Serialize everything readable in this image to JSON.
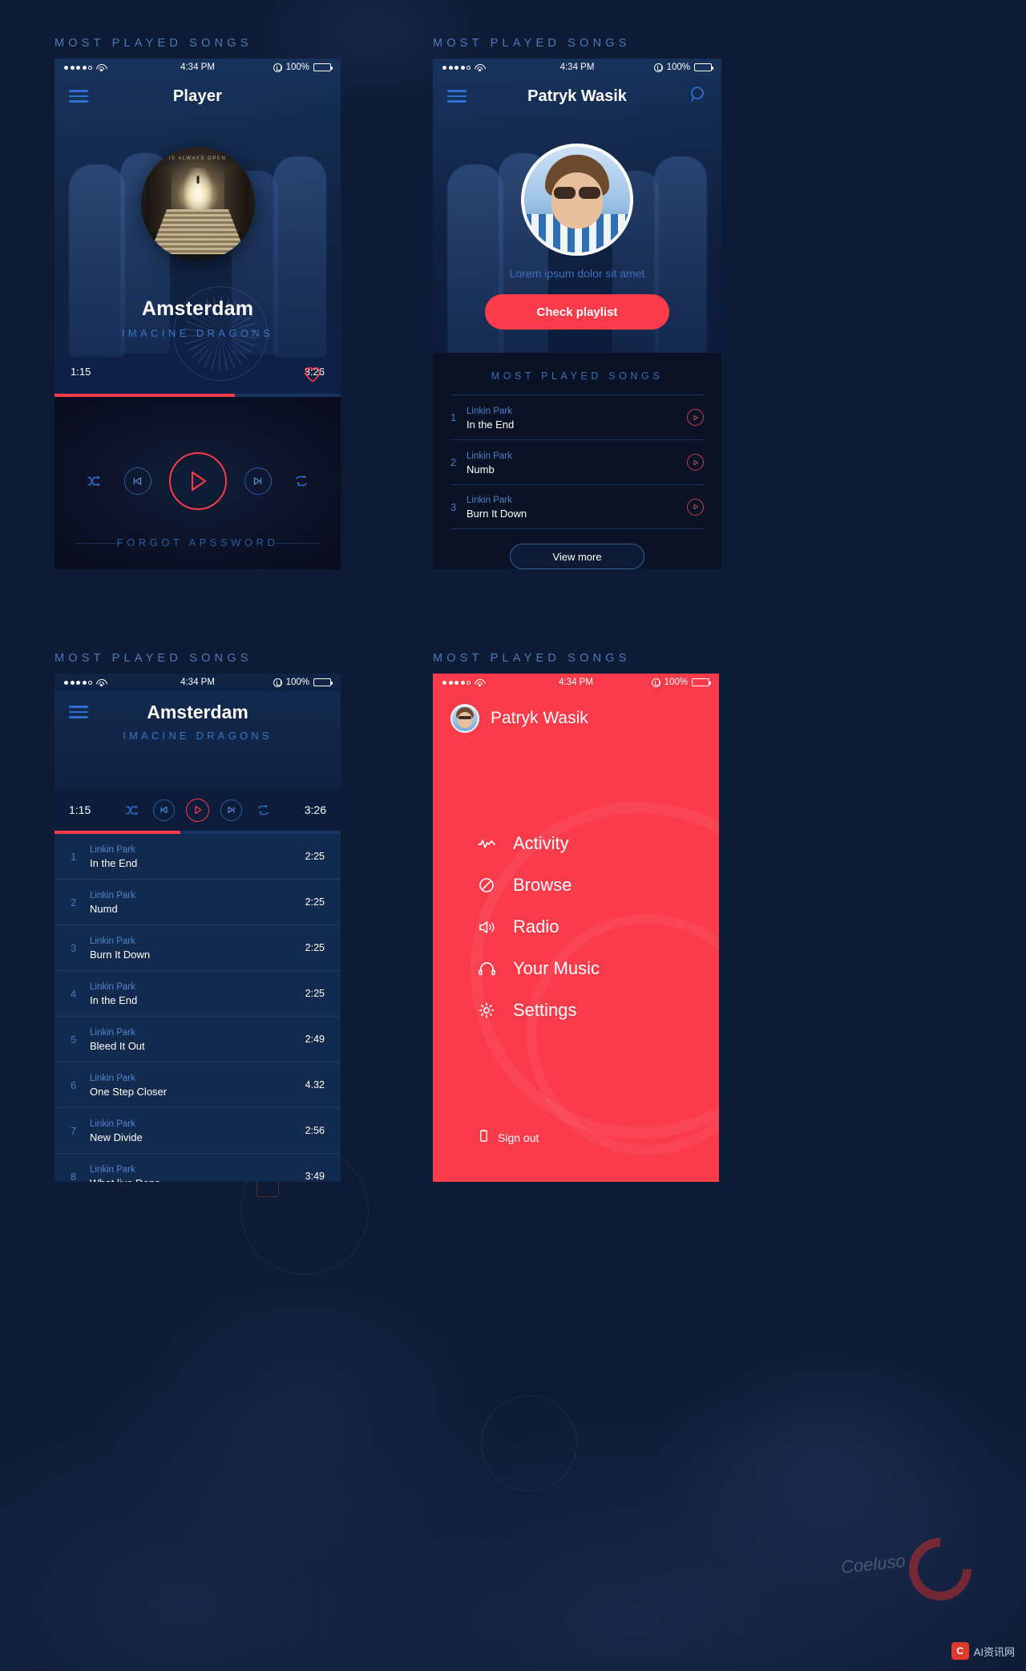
{
  "theme": {
    "accent_red": "#fa3b4a",
    "blue_text": "#3f74c4",
    "bg_dark_navy": "#0d1b35",
    "panel_navy": "#132a4f"
  },
  "section_labels": {
    "phone1": "MOST PLAYED SONGS",
    "phone2": "MOST PLAYED SONGS",
    "phone3": "MOST PLAYED SONGS",
    "phone4": "MOST PLAYED SONGS"
  },
  "status_bar": {
    "time": "4:34 PM",
    "battery": "100%",
    "signal_dots_filled": 4,
    "signal_dots_total": 5,
    "wifi_icon": "wifi-icon",
    "lock_icon": "rotation-lock-icon",
    "battery_icon": "battery-icon"
  },
  "phone1": {
    "menu_icon": "hamburger-menu-icon",
    "title": "Player",
    "album_art_caption": "IS ALWAYS OPEN",
    "track_title": "Amsterdam",
    "track_artist": "IMACINE DRAGONS",
    "favorite_icon": "heart-icon",
    "current_time": "1:15",
    "total_time": "3:26",
    "progress_percent": 63,
    "controls": {
      "shuffle": "shuffle-icon",
      "previous": "previous-track-icon",
      "play": "play-icon",
      "next": "next-track-icon",
      "repeat": "repeat-icon"
    },
    "footer_text": "FORGOT APSSWORD"
  },
  "phone2": {
    "menu_icon": "hamburger-menu-icon",
    "title": "Patryk Wasik",
    "search_icon": "search-icon",
    "avatar": "user-avatar",
    "subtitle": "Lorem ipsum dolor sit amet",
    "cta_label": "Check playlist",
    "section_title": "MOST PLAYED SONGS",
    "playlist": [
      {
        "num": "1",
        "artist": "Linkin Park",
        "song": "In the End",
        "play_icon": "play-circle-icon"
      },
      {
        "num": "2",
        "artist": "Linkin Park",
        "song": "Numb",
        "play_icon": "play-circle-icon"
      },
      {
        "num": "3",
        "artist": "Linkin Park",
        "song": "Burn It Down",
        "play_icon": "play-circle-icon"
      }
    ],
    "view_more_label": "View more"
  },
  "phone3": {
    "menu_icon": "hamburger-menu-icon",
    "title": "Amsterdam",
    "artist": "IMACINE DRAGONS",
    "current_time": "1:15",
    "total_time": "3:26",
    "progress_percent": 44,
    "controls": {
      "shuffle": "shuffle-icon",
      "previous": "previous-track-icon",
      "play": "play-icon",
      "next": "next-track-icon",
      "repeat": "repeat-icon"
    },
    "tracks": [
      {
        "num": "1",
        "artist": "Linkin Park",
        "song": "In the End",
        "duration": "2:25"
      },
      {
        "num": "2",
        "artist": "Linkin Park",
        "song": "Numd",
        "duration": "2:25"
      },
      {
        "num": "3",
        "artist": "Linkin Park",
        "song": "Burn It Down",
        "duration": "2:25"
      },
      {
        "num": "4",
        "artist": "Linkin Park",
        "song": "In the End",
        "duration": "2:25"
      },
      {
        "num": "5",
        "artist": "Linkin Park",
        "song": "Bleed It Out",
        "duration": "2:49"
      },
      {
        "num": "6",
        "artist": "Linkin Park",
        "song": "One Step Closer",
        "duration": "4.32"
      },
      {
        "num": "7",
        "artist": "Linkin Park",
        "song": "New Divide",
        "duration": "2:56"
      },
      {
        "num": "8",
        "artist": "Linkin Park",
        "song": "What live Done",
        "duration": "3:49"
      }
    ]
  },
  "phone4": {
    "avatar": "user-avatar",
    "username": "Patryk Wasik",
    "menu": [
      {
        "label": "Activity",
        "icon": "activity-pulse-icon"
      },
      {
        "label": "Browse",
        "icon": "browse-ban-icon"
      },
      {
        "label": "Radio",
        "icon": "radio-speaker-icon"
      },
      {
        "label": "Your Music",
        "icon": "headphones-icon"
      },
      {
        "label": "Settings",
        "icon": "gear-icon"
      }
    ],
    "sign_out_label": "Sign out",
    "sign_out_icon": "logout-icon"
  },
  "watermark": {
    "brand": "Coeluso",
    "badge_label": "AI资讯网",
    "badge_mark": "C"
  }
}
